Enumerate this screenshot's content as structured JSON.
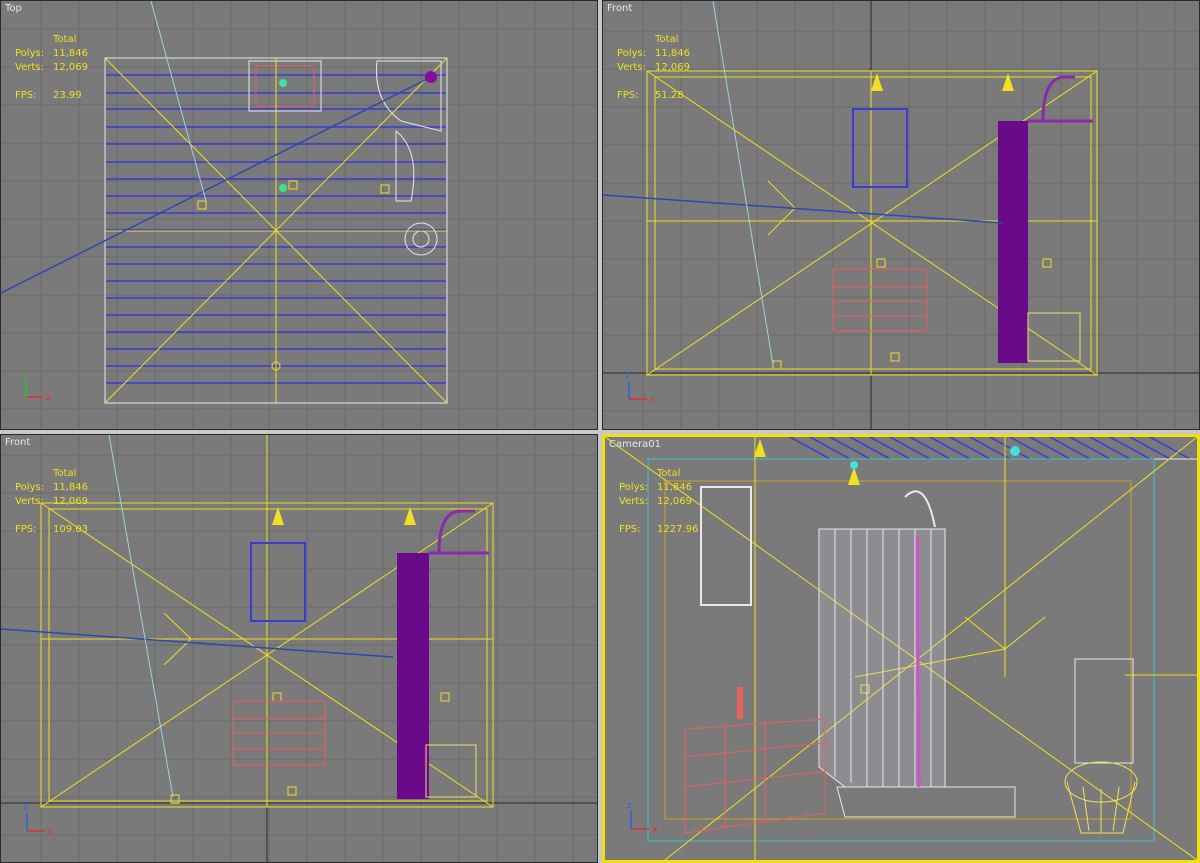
{
  "viewports": {
    "top": {
      "title": "Top",
      "stats": {
        "header": "Total",
        "polys_label": "Polys:",
        "polys": "11,846",
        "verts_label": "Verts:",
        "verts": "12,069",
        "fps_label": "FPS:",
        "fps": "23.99"
      }
    },
    "front_right": {
      "title": "Front",
      "stats": {
        "header": "Total",
        "polys_label": "Polys:",
        "polys": "11,846",
        "verts_label": "Verts:",
        "verts": "12,069",
        "fps_label": "FPS:",
        "fps": "51.28"
      }
    },
    "front_left": {
      "title": "Front",
      "stats": {
        "header": "Total",
        "polys_label": "Polys:",
        "polys": "11,846",
        "verts_label": "Verts:",
        "verts": "12,069",
        "fps_label": "FPS:",
        "fps": "109.03"
      }
    },
    "camera": {
      "title": "Camera01",
      "stats": {
        "header": "Total",
        "polys_label": "Polys:",
        "polys": "11,846",
        "verts_label": "Verts:",
        "verts": "12,069",
        "fps_label": "FPS:",
        "fps": "1227.96"
      }
    }
  },
  "axis_labels": {
    "x": "x",
    "y": "y",
    "z": "z"
  },
  "colors": {
    "viewport_bg": "#7a7a7a",
    "grid": "#666666",
    "grid_major": "#3a3a3a",
    "light_helper": "#f0e020",
    "shower": "#6a0a8a",
    "wall_lines": "#3a3ad8",
    "sink_wire": "#e86060",
    "camera_line": "#2a4ab0",
    "active_border": "#f0e010"
  }
}
